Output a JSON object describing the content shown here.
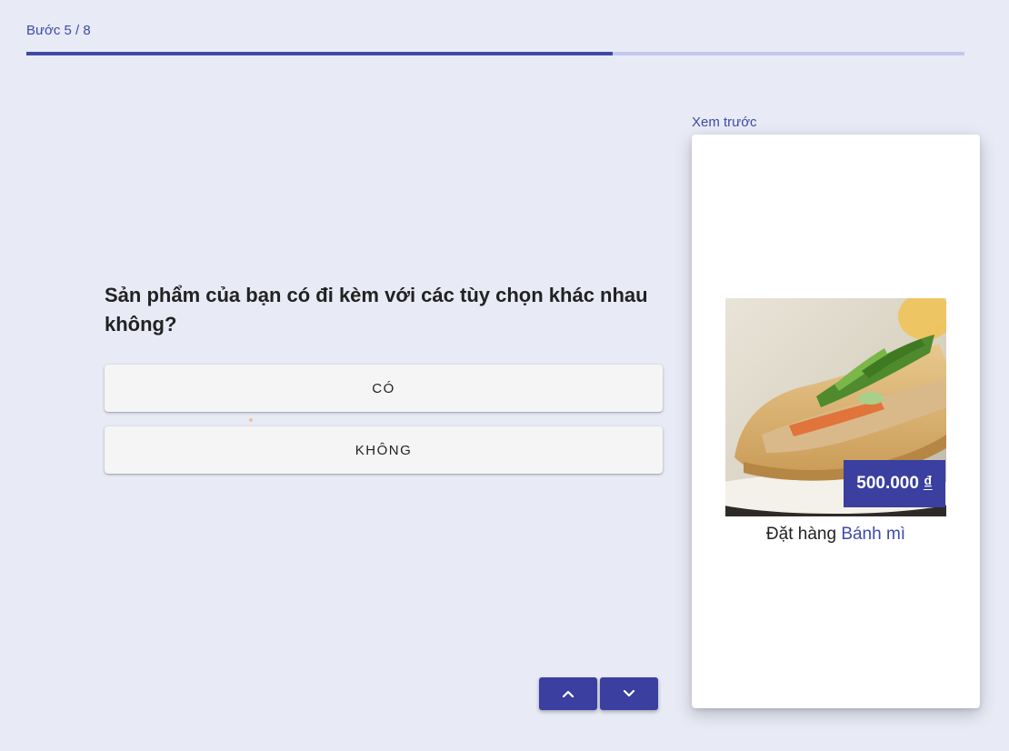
{
  "progress": {
    "step_text": "Bước 5 / 8",
    "current": 5,
    "total": 8,
    "fill_color": "#3f48a8",
    "track_color": "#c5c8ec"
  },
  "question": {
    "text": "Sản phẩm của bạn có đi kèm với các tùy chọn khác nhau không?",
    "answers": [
      "CÓ",
      "KHÔNG"
    ]
  },
  "navigation": {
    "up_icon": "chevron-up-icon",
    "down_icon": "chevron-down-icon",
    "button_color": "#3a3fa0"
  },
  "preview": {
    "label": "Xem trước",
    "price": "500.000",
    "currency": "₫",
    "order_prefix": "Đặt hàng",
    "product_name": "Bánh mì",
    "image": "banh-mi-sandwich-photo"
  },
  "colors": {
    "background": "#e8eaf6",
    "accent": "#3f4aa8"
  }
}
